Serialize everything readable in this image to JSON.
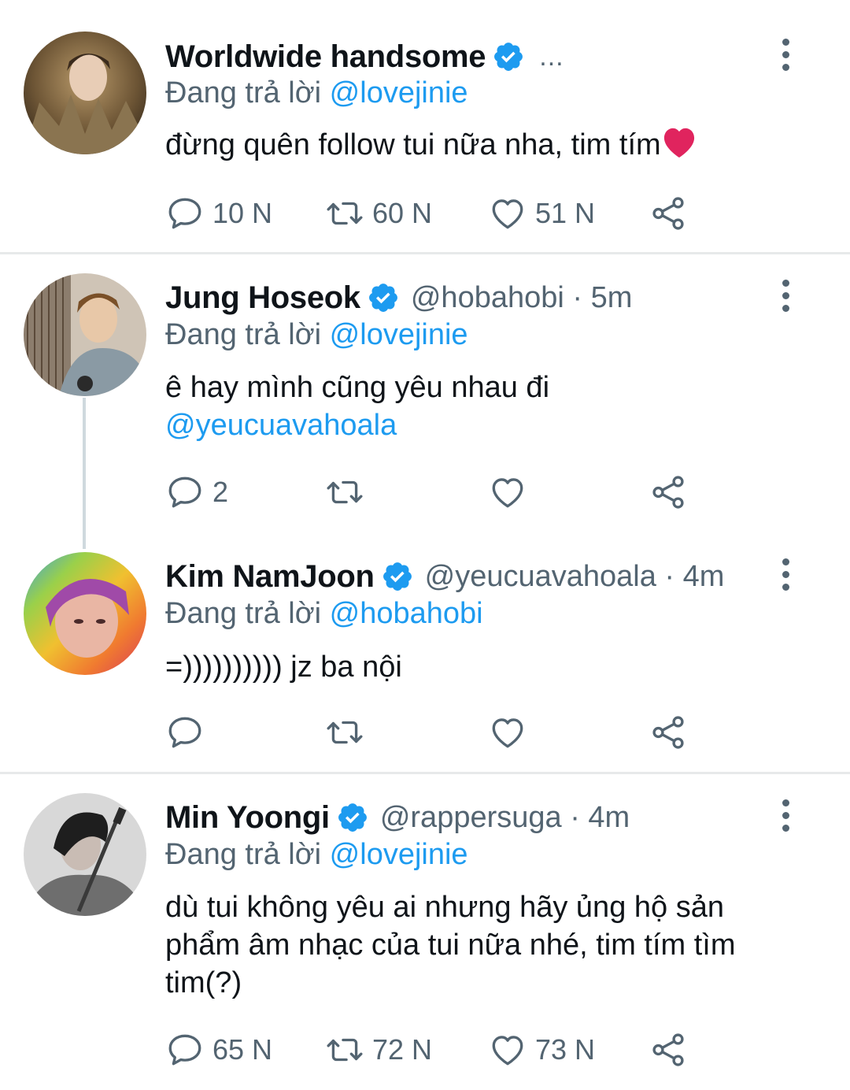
{
  "colors": {
    "accent": "#1d9bf0",
    "secondary_text": "#536471",
    "primary_text": "#0f1419",
    "heart": "#e0245e"
  },
  "tweets": [
    {
      "name": "Worldwide handsome",
      "handle": "",
      "time": "",
      "overflow": "...",
      "reply_prefix": "Đang trả lời",
      "reply_to": "@lovejinie",
      "text": "đừng quên follow tui nữa nha, tim tím",
      "emoji": "heart",
      "replies": "10 N",
      "retweets": "60 N",
      "likes": "51 N"
    },
    {
      "name": "Jung Hoseok",
      "handle": "@hobahobi · 5m",
      "reply_prefix": "Đang trả lời",
      "reply_to": "@lovejinie",
      "text_line1": "ê hay mình cũng yêu nhau đi",
      "text_mention": "@yeucuavahoala",
      "replies": "2",
      "retweets": "",
      "likes": ""
    },
    {
      "name": "Kim NamJoon",
      "handle": "@yeucuavahoala · 4m",
      "reply_prefix": "Đang trả lời",
      "reply_to": "@hobahobi",
      "text": "=)))))))))) jz ba nội",
      "replies": "",
      "retweets": "",
      "likes": ""
    },
    {
      "name": "Min Yoongi",
      "handle": "@rappersuga · 4m",
      "reply_prefix": "Đang trả lời",
      "reply_to": "@lovejinie",
      "text": "dù tui không yêu ai nhưng hãy ủng hộ sản phẩm âm nhạc của tui nữa nhé, tim tím tìm tim(?)",
      "replies": "65 N",
      "retweets": "72 N",
      "likes": "73 N"
    }
  ]
}
